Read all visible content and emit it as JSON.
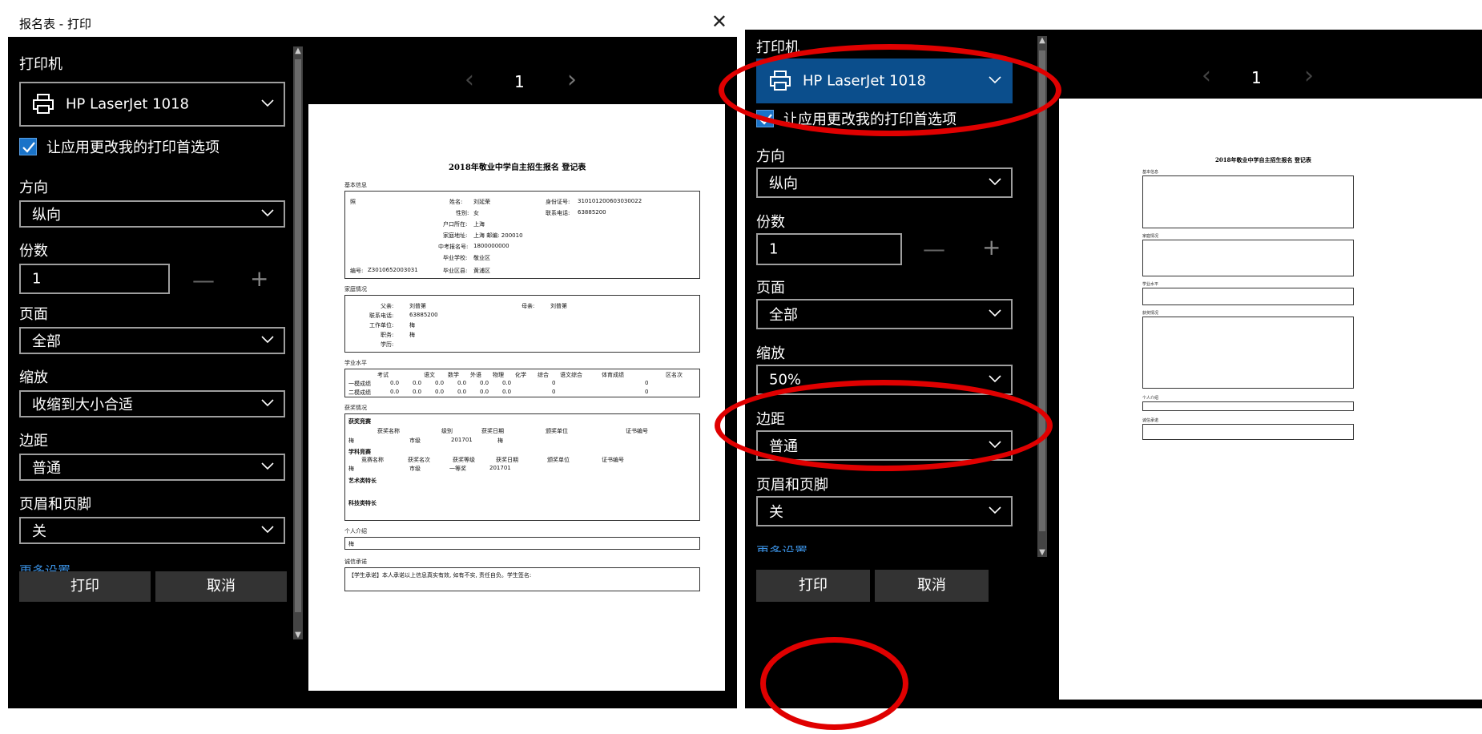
{
  "left": {
    "window_title": "报名表 - 打印",
    "close_glyph": "✕",
    "printer_label": "打印机",
    "printer_value": "HP LaserJet 1018",
    "allow_prefs_label": "让应用更改我的打印首选项",
    "orientation_label": "方向",
    "orientation_value": "纵向",
    "copies_label": "份数",
    "copies_value": "1",
    "pages_label": "页面",
    "pages_value": "全部",
    "scale_label": "缩放",
    "scale_value": "收缩到大小合适",
    "margins_label": "边距",
    "margins_value": "普通",
    "header_footer_label": "页眉和页脚",
    "header_footer_value": "关",
    "more_settings": "更多设置",
    "print_button": "打印",
    "cancel_button": "取消",
    "page_number": "1"
  },
  "right": {
    "printer_label": "打印机",
    "printer_value": "HP LaserJet 1018",
    "allow_prefs_label": "让应用更改我的打印首选项",
    "orientation_label": "方向",
    "orientation_value": "纵向",
    "copies_label": "份数",
    "copies_value": "1",
    "pages_label": "页面",
    "pages_value": "全部",
    "scale_label": "缩放",
    "scale_value": "50%",
    "margins_label": "边距",
    "margins_value": "普通",
    "header_footer_label": "页眉和页脚",
    "header_footer_value": "关",
    "more_settings": "更多设置",
    "print_button": "打印",
    "cancel_button": "取消",
    "page_number": "1"
  },
  "stepper": {
    "minus": "—",
    "plus": "+"
  },
  "pager_nav": {
    "prev": "‹",
    "next": "›"
  },
  "document": {
    "title": "2018年敬业中学自主招生报名 登记表",
    "sections": [
      "基本信息",
      "家庭情况",
      "学业水平",
      "获奖情况",
      "个人介绍",
      "诚信承诺"
    ],
    "basic": {
      "name_label": "姓名:",
      "name_value": "刘延荣",
      "gender_label": "性别:",
      "gender_value": "女",
      "id_label": "身份证号:",
      "id_value": "310101200603030022",
      "phone_label": "联系电话:",
      "phone_value": "63885200",
      "hukou_label": "户口所在:",
      "hukou_value": "上海",
      "address_label": "家庭地址:",
      "address_value": "上海 邮编: 200010",
      "exam_label": "中考报名号:",
      "exam_value": "1800000000",
      "school_label": "毕业学校:",
      "school_value": "敬业区",
      "district_label": "毕业区县:",
      "district_value": "黄浦区",
      "reg_label": "编号:",
      "reg_value": "Z3010652003031",
      "photo_label": "照"
    },
    "family": {
      "father_label": "父亲:",
      "father_value": "刘普第",
      "mother_label": "母亲:",
      "mother_value": "刘普第",
      "phone_label": "联系电话:",
      "phone_value": "63885200",
      "work_label": "工作单位:",
      "work_value": "梅",
      "duty_label": "职务:",
      "duty_value": "梅",
      "edu_label": "学历:"
    },
    "scores": {
      "headers": [
        "考试",
        "语文",
        "数学",
        "外语",
        "物理",
        "化学",
        "综合",
        "语文综合",
        "体育成绩",
        "区名次"
      ],
      "rows": [
        [
          "一模成绩",
          "0.0",
          "0.0",
          "0.0",
          "0.0",
          "0.0",
          "0.0",
          "0",
          "",
          "0"
        ],
        [
          "二模成绩",
          "0.0",
          "0.0",
          "0.0",
          "0.0",
          "0.0",
          "0.0",
          "0",
          "",
          "0"
        ]
      ]
    },
    "awards": {
      "sub1": "获奖竞赛",
      "sub2": "学科竞赛",
      "sub3": "艺术类特长",
      "sub4": "科技类特长",
      "headers1": [
        "获奖名称",
        "级别",
        "获奖日期",
        "颁奖单位",
        "证书编号"
      ],
      "row1": [
        "梅",
        "市级",
        "201701",
        "梅",
        ""
      ],
      "headers2": [
        "竞赛名称",
        "获奖名次",
        "获奖等级",
        "获奖日期",
        "颁奖单位",
        "证书编号"
      ],
      "row2": [
        "梅",
        "市级",
        "一等奖",
        "201701",
        "梅",
        ""
      ]
    },
    "intro_value": "梅",
    "pledge": "【学生承诺】本人承诺以上信息真实有效, 如有不实, 责任自负。学生签名:"
  }
}
